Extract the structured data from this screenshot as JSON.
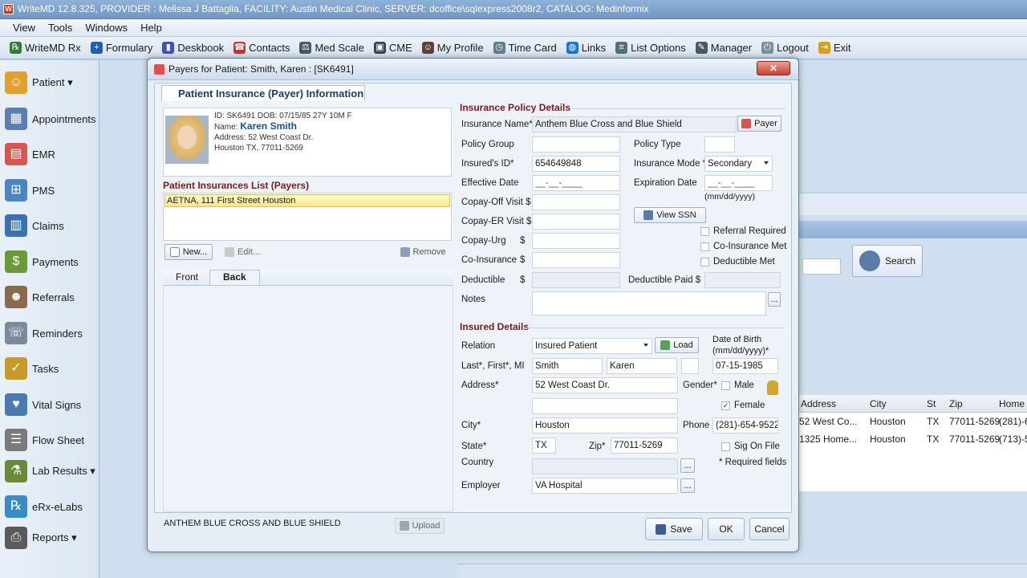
{
  "window": {
    "title": "WriteMD 12.8.325, PROVIDER : Melissa J Battaglia, FACILITY: Austin Medical Clinic, SERVER: dcoffice\\sqlexpress2008r2, CATALOG: Medinformix"
  },
  "menu": [
    "View",
    "Tools",
    "Windows",
    "Help"
  ],
  "toolbar": [
    {
      "label": "WriteMD Rx",
      "icon": "rx-icon",
      "color": "#2e7d32"
    },
    {
      "label": "Formulary",
      "icon": "formulary-icon",
      "color": "#1e5fb3"
    },
    {
      "label": "Deskbook",
      "icon": "book-icon",
      "color": "#3f51b5"
    },
    {
      "label": "Contacts",
      "icon": "contacts-icon",
      "color": "#c0392b"
    },
    {
      "label": "Med Scale",
      "icon": "scale-icon",
      "color": "#455a64"
    },
    {
      "label": "CME",
      "icon": "cme-icon",
      "color": "#37474f"
    },
    {
      "label": "My Profile",
      "icon": "profile-icon",
      "color": "#5d4037"
    },
    {
      "label": "Time Card",
      "icon": "clock-icon",
      "color": "#607d8b"
    },
    {
      "label": "Links",
      "icon": "globe-icon",
      "color": "#1976d2"
    },
    {
      "label": "List Options",
      "icon": "list-icon",
      "color": "#546e7a"
    },
    {
      "label": "Manager",
      "icon": "manager-icon",
      "color": "#455a64"
    },
    {
      "label": "Logout",
      "icon": "logout-icon",
      "color": "#78909c"
    },
    {
      "label": "Exit",
      "icon": "exit-icon",
      "color": "#d4a017"
    }
  ],
  "sidebar": [
    {
      "label": "Patient ▾",
      "icon": "patient-icon",
      "color": "#e0a030"
    },
    {
      "label": "Appointments",
      "icon": "calendar-icon",
      "color": "#5b7fb5"
    },
    {
      "label": "EMR",
      "icon": "emr-icon",
      "color": "#d9534f"
    },
    {
      "label": "PMS",
      "icon": "pms-icon",
      "color": "#4a86c5"
    },
    {
      "label": "Claims",
      "icon": "claims-icon",
      "color": "#3a72b0"
    },
    {
      "label": "Payments",
      "icon": "payments-icon",
      "color": "#6a9a3a"
    },
    {
      "label": "Referrals",
      "icon": "referrals-icon",
      "color": "#8a6a4a"
    },
    {
      "label": "Reminders",
      "icon": "phone-icon",
      "color": "#7a8a9a"
    },
    {
      "label": "Tasks",
      "icon": "tasks-icon",
      "color": "#c79a2a"
    },
    {
      "label": "Vital Signs",
      "icon": "vitals-icon",
      "color": "#4a7ab0"
    },
    {
      "label": "Flow Sheet",
      "icon": "flowsheet-icon",
      "color": "#7a7a7a"
    },
    {
      "label": "Lab Results ▾",
      "icon": "lab-icon",
      "color": "#6a8a3a"
    },
    {
      "label": "eRx-eLabs",
      "icon": "erx-icon",
      "color": "#3a8ac5"
    },
    {
      "label": "Reports ▾",
      "icon": "printer-icon",
      "color": "#5a5a5a"
    }
  ],
  "background": {
    "search_label": "Search",
    "table_headers": [
      "Address",
      "City",
      "St",
      "Zip",
      "Home"
    ],
    "rows": [
      [
        "52 West Co...",
        "Houston",
        "TX",
        "77011-5269",
        "(281)-6"
      ],
      [
        "1325 Home...",
        "Houston",
        "TX",
        "77011-5269",
        "(713)-5"
      ]
    ]
  },
  "dialog": {
    "title": "Payers for Patient: Smith, Karen : [SK6491]",
    "close": "✕",
    "tab": "Patient Insurance (Payer) Information",
    "patient": {
      "id_line": "ID: SK6491      DOB: 07/15/85  27Y 10M F",
      "name_label": "Name:",
      "name": "Karen Smith",
      "address_line1": "Address: 52 West Coast Dr.",
      "address_line2": "Houston  TX, 77011-5269"
    },
    "list_title": "Patient Insurances List (Payers)",
    "list_items": [
      "AETNA, 111 First Street Houston"
    ],
    "new_btn": "New...",
    "edit_btn": "Edit...",
    "remove_btn": "Remove",
    "front_tab": "Front",
    "back_tab": "Back",
    "card_caption": "ANTHEM BLUE CROSS AND BLUE SHIELD",
    "upload_btn": "Upload",
    "policy": {
      "section_title": "Insurance Policy Details",
      "insurance_name_label": "Insurance Name*",
      "insurance_name": "Anthem Blue Cross and Blue Shield",
      "payer_btn": "Payer",
      "policy_group_label": "Policy Group",
      "policy_type_label": "Policy Type",
      "insured_id_label": "Insured's ID*",
      "insured_id": "654649848",
      "insurance_mode_label": "Insurance Mode *",
      "insurance_mode": "Secondary",
      "effective_date_label": "Effective Date",
      "effective_date": "__-__-____",
      "expiration_date_label": "Expiration Date",
      "expiration_date": "__-__-____",
      "date_hint": "(mm/dd/yyyy)",
      "copay_office_label": "Copay-Off Visit $",
      "copay_er_label": "Copay-ER Visit $",
      "view_ssn_btn": "View SSN",
      "copay_urg_label": "Copay-Urg",
      "copay_urg_symbol": "$",
      "coinsurance_label": "Co-Insurance",
      "coinsurance_symbol": "$",
      "deductible_label": "Deductible",
      "deductible_symbol": "$",
      "deductible_paid_label": "Deductible Paid $",
      "referral_required": "Referral Required",
      "coinsurance_met": "Co-Insurance Met",
      "deductible_met": "Deductible Met",
      "notes_label": "Notes",
      "notes_more": "..."
    },
    "insured": {
      "section_title": "Insured Details",
      "relation_label": "Relation",
      "relation": "Insured Patient",
      "load_btn": "Load",
      "dob_label": "Date of Birth\n(mm/dd/yyyy)*",
      "dob_label_1": "Date of Birth",
      "dob_label_2": "(mm/dd/yyyy)*",
      "name_label": "Last*, First*, MI",
      "last": "Smith",
      "first": "Karen",
      "mi": "",
      "dob": "07-15-1985",
      "address_label": "Address*",
      "address1": "52 West Coast Dr.",
      "address2": "",
      "gender_label": "Gender*",
      "male": "Male",
      "female": "Female",
      "female_checked": "✓",
      "city_label": "City*",
      "city": "Houston",
      "phone_label": "Phone",
      "phone": "(281)-654-9522",
      "state_label": "State*",
      "state": "TX",
      "zip_label": "Zip*",
      "zip": "77011-5269",
      "sig_on_file": "Sig On File",
      "country_label": "Country",
      "country": "",
      "required_note": "* Required fields",
      "employer_label": "Employer",
      "employer": "VA Hospital",
      "more": "..."
    },
    "save_btn": "Save",
    "ok_btn": "OK",
    "cancel_btn": "Cancel"
  }
}
